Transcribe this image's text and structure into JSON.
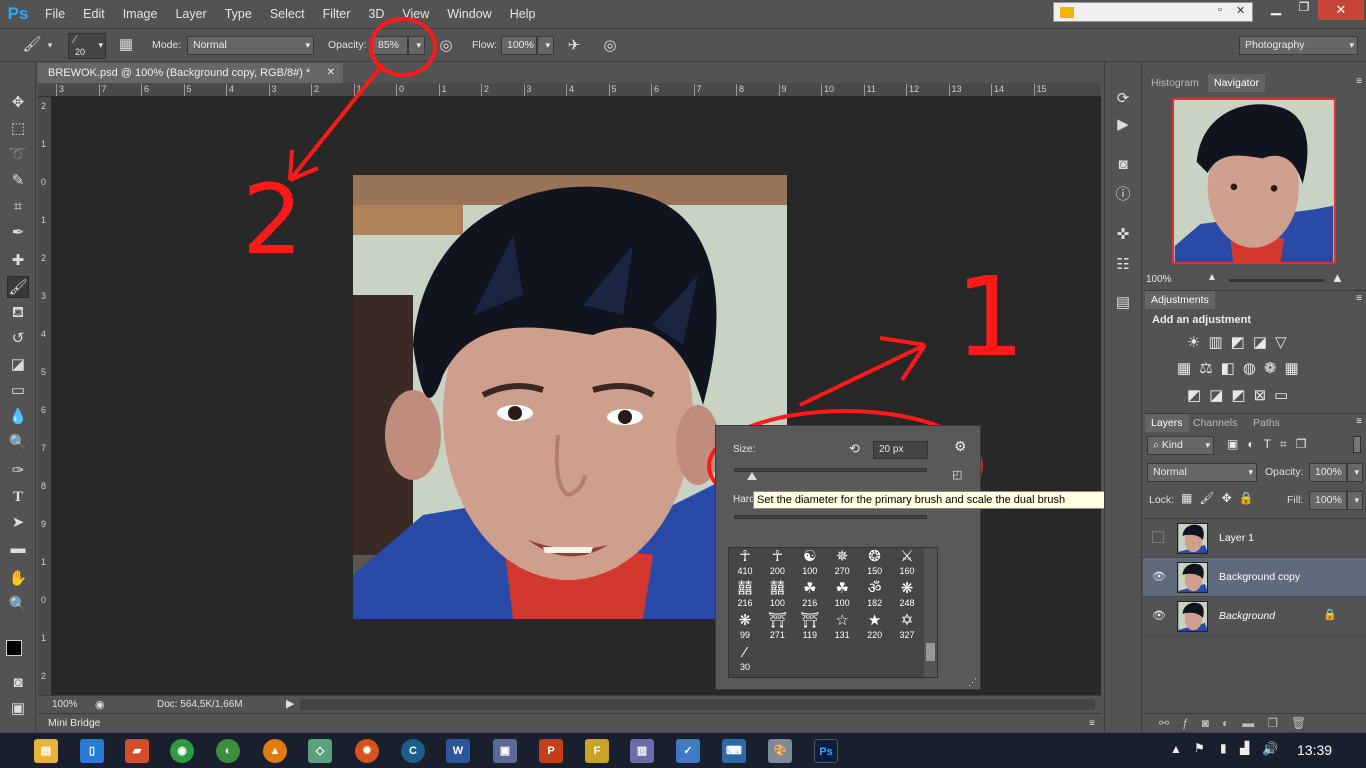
{
  "app": {
    "logo": "Ps"
  },
  "menu": [
    "File",
    "Edit",
    "Image",
    "Layer",
    "Type",
    "Select",
    "Filter",
    "3D",
    "View",
    "Window",
    "Help"
  ],
  "options": {
    "brush_size": "20",
    "mode_label": "Mode:",
    "mode_value": "Normal",
    "opacity_label": "Opacity:",
    "opacity_value": "85%",
    "flow_label": "Flow:",
    "flow_value": "100%",
    "workspace": "Photography"
  },
  "document": {
    "tab_title": "BREWOK.psd @ 100% (Background copy, RGB/8#) *",
    "ruler_top_ticks": [
      "3",
      "7",
      "6",
      "5",
      "4",
      "3",
      "2",
      "1",
      "0",
      "1",
      "2",
      "3",
      "4",
      "5",
      "6",
      "7",
      "8",
      "9",
      "10",
      "11",
      "12",
      "13",
      "14",
      "15"
    ],
    "ruler_left_ticks": [
      "2",
      "1",
      "0",
      "1",
      "2",
      "3",
      "4",
      "5",
      "6",
      "7",
      "8",
      "9",
      "1",
      "0",
      "1",
      "2"
    ],
    "zoom": "100%",
    "doc_info": "Doc: 564,5K/1,66M"
  },
  "mini_bridge": "Mini Bridge",
  "brush_picker": {
    "size_label": "Size:",
    "size_value": "20 px",
    "hardness_label": "Hardness:",
    "brushes": [
      {
        "glyph": "☥",
        "size": "410"
      },
      {
        "glyph": "☥",
        "size": "200"
      },
      {
        "glyph": "☯",
        "size": "100"
      },
      {
        "glyph": "✵",
        "size": "270"
      },
      {
        "glyph": "❂",
        "size": "150"
      },
      {
        "glyph": "⚔",
        "size": "160"
      },
      {
        "glyph": "囍",
        "size": "216"
      },
      {
        "glyph": "囍",
        "size": "100"
      },
      {
        "glyph": "☘",
        "size": "216"
      },
      {
        "glyph": "☘",
        "size": "100"
      },
      {
        "glyph": "ॐ",
        "size": "182"
      },
      {
        "glyph": "❋",
        "size": "248"
      },
      {
        "glyph": "❋",
        "size": "99"
      },
      {
        "glyph": "⛩",
        "size": "271"
      },
      {
        "glyph": "⛩",
        "size": "119"
      },
      {
        "glyph": "☆",
        "size": "131"
      },
      {
        "glyph": "★",
        "size": "220"
      },
      {
        "glyph": "✡",
        "size": "327"
      },
      {
        "glyph": "⁄",
        "size": "30"
      }
    ]
  },
  "tooltip": "Set the diameter for the primary brush and scale the dual brush",
  "annotations": {
    "one": "1",
    "two": "2"
  },
  "navigator": {
    "tabs": [
      "Histogram",
      "Navigator"
    ],
    "zoom": "100%"
  },
  "adjustments": {
    "tab": "Adjustments",
    "title": "Add an adjustment"
  },
  "layers_panel": {
    "tabs": [
      "Layers",
      "Channels",
      "Paths"
    ],
    "filter_kind": "Kind",
    "blend_mode": "Normal",
    "opacity_label": "Opacity:",
    "opacity_value": "100%",
    "lock_label": "Lock:",
    "fill_label": "Fill:",
    "fill_value": "100%",
    "layers": [
      {
        "name": "Layer 1",
        "visible": false,
        "selected": false,
        "italic": false,
        "locked": false
      },
      {
        "name": "Background copy",
        "visible": true,
        "selected": true,
        "italic": false,
        "locked": false
      },
      {
        "name": "Background",
        "visible": true,
        "selected": false,
        "italic": true,
        "locked": true
      }
    ]
  },
  "taskbar": {
    "time": "13:39"
  }
}
